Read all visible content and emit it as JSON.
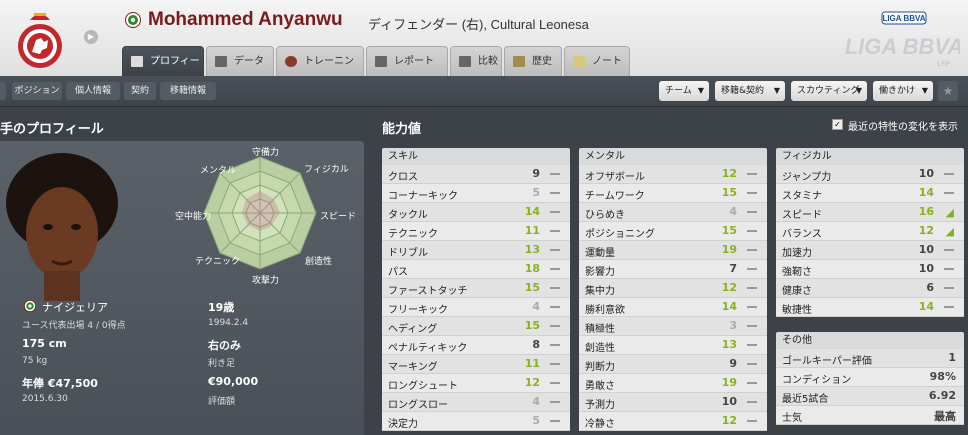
{
  "header": {
    "player_name": "Mohammed Anyanwu",
    "player_sub": "ディフェンダー (右), Cultural Leonesa",
    "league_top": "LIGA BBVA",
    "league_main": "LIGA BBVA",
    "league_lfp": "LFP"
  },
  "tabs": [
    {
      "label": "プロフィール",
      "active": true
    },
    {
      "label": "データ"
    },
    {
      "label": "トレーニング"
    },
    {
      "label": "レポート"
    },
    {
      "label": "比較"
    },
    {
      "label": "歴史"
    },
    {
      "label": "ノート"
    }
  ],
  "subnav": [
    "ポジション",
    "個人情報",
    "契約",
    "移籍情報"
  ],
  "toolbar_menus": [
    "チーム",
    "移籍&契約",
    "スカウティング",
    "働きかけ"
  ],
  "profile": {
    "title": "手のプロフィール",
    "radar_labels": {
      "top": "守備力",
      "right_top": "フィジカル",
      "right": "スピード",
      "right_bottom": "創造性",
      "bottom": "攻撃力",
      "left_bottom": "テクニック",
      "left": "空中能力",
      "left_top": "メンタル"
    },
    "nationality": "ナイジェリア",
    "caps": "ユース代表出場 4 / 0得点",
    "age": "19歳",
    "dob": "1994.2.4",
    "height": "175 cm",
    "weight": "75 kg",
    "foot": "右のみ",
    "foot_label": "利き足",
    "wage": "年俸 €47,500",
    "contract_end": "2015.6.30",
    "value": "€90,000",
    "value_label": "評価額"
  },
  "attributes": {
    "title": "能力値",
    "show_changes_label": "最近の特性の変化を表示",
    "skill": {
      "title": "スキル",
      "rows": [
        {
          "name": "クロス",
          "value": "9"
        },
        {
          "name": "コーナーキック",
          "value": "5"
        },
        {
          "name": "タックル",
          "value": "14"
        },
        {
          "name": "テクニック",
          "value": "11"
        },
        {
          "name": "ドリブル",
          "value": "13"
        },
        {
          "name": "パス",
          "value": "18"
        },
        {
          "name": "ファーストタッチ",
          "value": "15"
        },
        {
          "name": "フリーキック",
          "value": "4"
        },
        {
          "name": "ヘディング",
          "value": "15"
        },
        {
          "name": "ペナルティキック",
          "value": "8"
        },
        {
          "name": "マーキング",
          "value": "11"
        },
        {
          "name": "ロングシュート",
          "value": "12"
        },
        {
          "name": "ロングスロー",
          "value": "4"
        },
        {
          "name": "決定力",
          "value": "5"
        }
      ]
    },
    "mental": {
      "title": "メンタル",
      "rows": [
        {
          "name": "オフザボール",
          "value": "12"
        },
        {
          "name": "チームワーク",
          "value": "15"
        },
        {
          "name": "ひらめき",
          "value": "4"
        },
        {
          "name": "ポジショニング",
          "value": "15"
        },
        {
          "name": "運動量",
          "value": "19"
        },
        {
          "name": "影響力",
          "value": "7"
        },
        {
          "name": "集中力",
          "value": "12"
        },
        {
          "name": "勝利意欲",
          "value": "14"
        },
        {
          "name": "積極性",
          "value": "3"
        },
        {
          "name": "創造性",
          "value": "13"
        },
        {
          "name": "判断力",
          "value": "9"
        },
        {
          "name": "勇敢さ",
          "value": "19"
        },
        {
          "name": "予測力",
          "value": "10"
        },
        {
          "name": "冷静さ",
          "value": "12"
        }
      ]
    },
    "physical": {
      "title": "フィジカル",
      "rows": [
        {
          "name": "ジャンプ力",
          "value": "10"
        },
        {
          "name": "スタミナ",
          "value": "14"
        },
        {
          "name": "スピード",
          "value": "16"
        },
        {
          "name": "バランス",
          "value": "12"
        },
        {
          "name": "加速力",
          "value": "10"
        },
        {
          "name": "強靭さ",
          "value": "10"
        },
        {
          "name": "健康さ",
          "value": "6"
        },
        {
          "name": "敏捷性",
          "value": "14"
        }
      ]
    },
    "other": {
      "title": "その他",
      "rows": [
        {
          "name": "ゴールキーパー評価",
          "value": "1"
        },
        {
          "name": "コンディション",
          "value": "98%"
        },
        {
          "name": "最近5試合",
          "value": "6.92"
        },
        {
          "name": "士気",
          "value": "最高"
        }
      ]
    }
  },
  "colors": {
    "accent_green": "#8ab120",
    "name_red": "#7a1b1b"
  }
}
